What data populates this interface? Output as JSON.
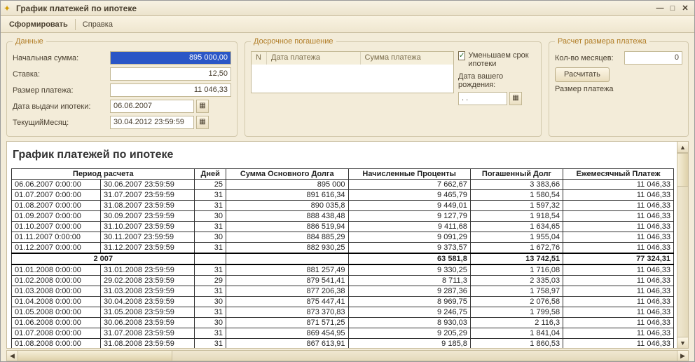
{
  "window": {
    "title": "График платежей по ипотеке"
  },
  "toolbar": {
    "generate": "Сформировать",
    "help": "Справка"
  },
  "data_group": {
    "legend": "Данные",
    "initial_sum_label": "Начальная сумма:",
    "initial_sum": "895 000,00",
    "rate_label": "Ставка:",
    "rate": "12,50",
    "payment_label": "Размер платежа:",
    "payment": "11 046,33",
    "issue_date_label": "Дата выдачи ипотеки:",
    "issue_date": "06.06.2007",
    "current_month_label": "ТекущийМесяц:",
    "current_month": "30.04.2012 23:59:59"
  },
  "early_group": {
    "legend": "Досрочное погашение",
    "col_n": "N",
    "col_date": "Дата платежа",
    "col_sum": "Сумма платежа",
    "reduce_term_label": "Уменьшаем срок ипотеки",
    "birth_label": "Дата вашего рождения:",
    "birth_value": " .  .    "
  },
  "calc_group": {
    "legend": "Расчет размера платежа",
    "months_label": "Кол-во месяцев:",
    "months_value": "0",
    "calc_btn": "Расчитать",
    "result_label": "Размер платежа"
  },
  "report": {
    "title": "График платежей по ипотеке",
    "headers": {
      "period": "Период расчета",
      "days": "Дней",
      "principal": "Сумма Основного Долга",
      "interest": "Начисленные Проценты",
      "repaid": "Погашенный Долг",
      "monthly": "Ежемесячный Платеж"
    },
    "rows": [
      {
        "from": "06.06.2007 0:00:00",
        "to": "30.06.2007 23:59:59",
        "days": "25",
        "principal": "895 000",
        "interest": "7 662,67",
        "repaid": "3 383,66",
        "monthly": "11 046,33"
      },
      {
        "from": "01.07.2007 0:00:00",
        "to": "31.07.2007 23:59:59",
        "days": "31",
        "principal": "891 616,34",
        "interest": "9 465,79",
        "repaid": "1 580,54",
        "monthly": "11 046,33"
      },
      {
        "from": "01.08.2007 0:00:00",
        "to": "31.08.2007 23:59:59",
        "days": "31",
        "principal": "890 035,8",
        "interest": "9 449,01",
        "repaid": "1 597,32",
        "monthly": "11 046,33"
      },
      {
        "from": "01.09.2007 0:00:00",
        "to": "30.09.2007 23:59:59",
        "days": "30",
        "principal": "888 438,48",
        "interest": "9 127,79",
        "repaid": "1 918,54",
        "monthly": "11 046,33"
      },
      {
        "from": "01.10.2007 0:00:00",
        "to": "31.10.2007 23:59:59",
        "days": "31",
        "principal": "886 519,94",
        "interest": "9 411,68",
        "repaid": "1 634,65",
        "monthly": "11 046,33"
      },
      {
        "from": "01.11.2007 0:00:00",
        "to": "30.11.2007 23:59:59",
        "days": "30",
        "principal": "884 885,29",
        "interest": "9 091,29",
        "repaid": "1 955,04",
        "monthly": "11 046,33"
      },
      {
        "from": "01.12.2007 0:00:00",
        "to": "31.12.2007 23:59:59",
        "days": "31",
        "principal": "882 930,25",
        "interest": "9 373,57",
        "repaid": "1 672,76",
        "monthly": "11 046,33"
      }
    ],
    "total2007": {
      "label": "2 007",
      "interest": "63 581,8",
      "repaid": "13 742,51",
      "monthly": "77 324,31"
    },
    "rows2": [
      {
        "from": "01.01.2008 0:00:00",
        "to": "31.01.2008 23:59:59",
        "days": "31",
        "principal": "881 257,49",
        "interest": "9 330,25",
        "repaid": "1 716,08",
        "monthly": "11 046,33"
      },
      {
        "from": "01.02.2008 0:00:00",
        "to": "29.02.2008 23:59:59",
        "days": "29",
        "principal": "879 541,41",
        "interest": "8 711,3",
        "repaid": "2 335,03",
        "monthly": "11 046,33"
      },
      {
        "from": "01.03.2008 0:00:00",
        "to": "31.03.2008 23:59:59",
        "days": "31",
        "principal": "877 206,38",
        "interest": "9 287,36",
        "repaid": "1 758,97",
        "monthly": "11 046,33"
      },
      {
        "from": "01.04.2008 0:00:00",
        "to": "30.04.2008 23:59:59",
        "days": "30",
        "principal": "875 447,41",
        "interest": "8 969,75",
        "repaid": "2 076,58",
        "monthly": "11 046,33"
      },
      {
        "from": "01.05.2008 0:00:00",
        "to": "31.05.2008 23:59:59",
        "days": "31",
        "principal": "873 370,83",
        "interest": "9 246,75",
        "repaid": "1 799,58",
        "monthly": "11 046,33"
      },
      {
        "from": "01.06.2008 0:00:00",
        "to": "30.06.2008 23:59:59",
        "days": "30",
        "principal": "871 571,25",
        "interest": "8 930,03",
        "repaid": "2 116,3",
        "monthly": "11 046,33"
      },
      {
        "from": "01.07.2008 0:00:00",
        "to": "31.07.2008 23:59:59",
        "days": "31",
        "principal": "869 454,95",
        "interest": "9 205,29",
        "repaid": "1 841,04",
        "monthly": "11 046,33"
      },
      {
        "from": "01.08.2008 0:00:00",
        "to": "31.08.2008 23:59:59",
        "days": "31",
        "principal": "867 613,91",
        "interest": "9 185,8",
        "repaid": "1 860,53",
        "monthly": "11 046,33"
      }
    ]
  }
}
